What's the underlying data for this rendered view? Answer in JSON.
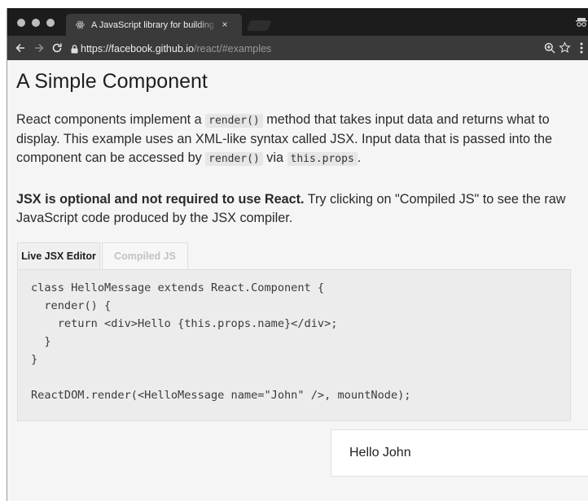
{
  "browser": {
    "tab_title": "A JavaScript library for building",
    "tab_close": "×",
    "url_host": "https://facebook.github.io",
    "url_path": "/react/#examples"
  },
  "page": {
    "heading": "A Simple Component",
    "p1": {
      "t1": "React components implement a ",
      "c1": "render()",
      "t2": " method that takes input data and returns what to display. This example uses an XML-like syntax called JSX. Input data that is passed into the component can be accessed by ",
      "c2": "render()",
      "t3": " via ",
      "c3": "this.props",
      "t4": "."
    },
    "p2": {
      "bold": "JSX is optional and not required to use React.",
      "rest": " Try clicking on \"Compiled JS\" to see the raw JavaScript code produced by the JSX compiler."
    },
    "editor": {
      "tabs": [
        "Live JSX Editor",
        "Compiled JS"
      ],
      "code": [
        "class HelloMessage extends React.Component {",
        "  render() {",
        "    return <div>Hello {this.props.name}</div>;",
        "  }",
        "}",
        "",
        "ReactDOM.render(<HelloMessage name=\"John\" />, mountNode);"
      ]
    },
    "output": "Hello John"
  },
  "icons": {
    "window_dots": [
      "window-close-dot",
      "window-minimize-dot",
      "window-zoom-dot"
    ],
    "favicon": "react-logo-icon",
    "toolbar": [
      "back-arrow-icon",
      "forward-arrow-icon",
      "reload-icon",
      "lock-icon",
      "zoom-icon",
      "star-icon",
      "menu-icon"
    ]
  },
  "colors": {
    "chrome_dark": "#1c1c1c",
    "toolbar": "#3a3a3a",
    "page_bg": "#f5f5f5",
    "code_bg": "#ececec"
  }
}
